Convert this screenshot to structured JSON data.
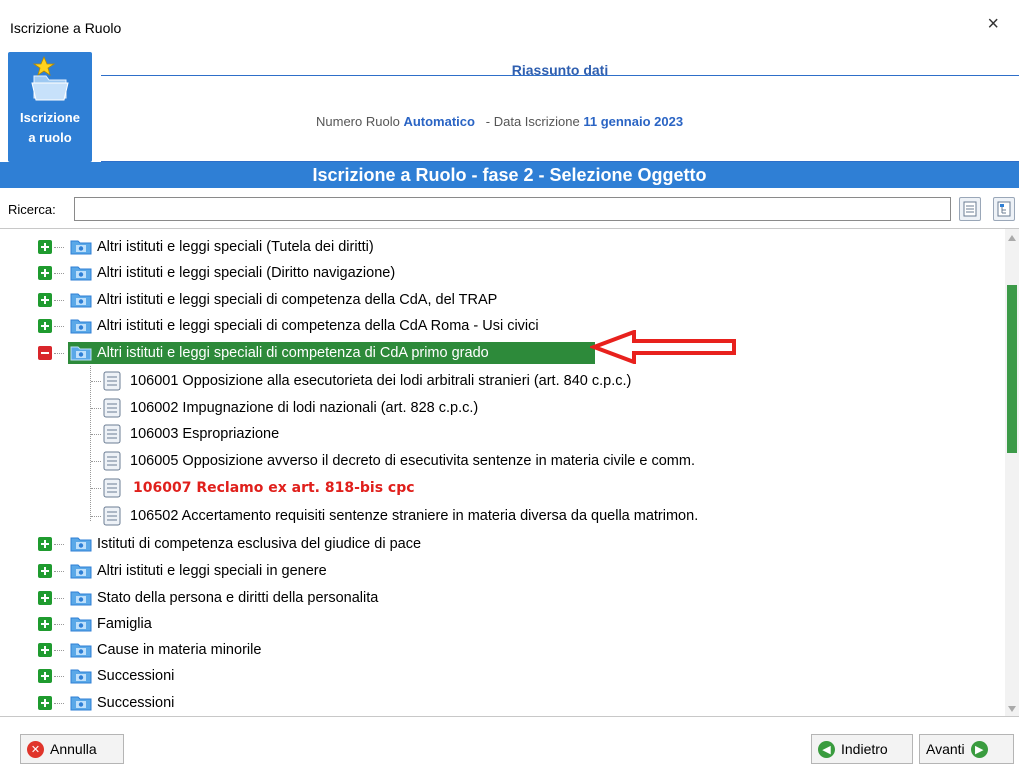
{
  "window": {
    "title": "Iscrizione a Ruolo",
    "close_glyph": "×"
  },
  "header": {
    "app_label_line1": "Iscrizione",
    "app_label_line2": "a ruolo",
    "summary_title": "Riassunto dati",
    "numero_label": "Numero Ruolo",
    "numero_value": "Automatico",
    "data_label": "- Data Iscrizione",
    "data_value": "11 gennaio 2023"
  },
  "phase_title": "Iscrizione a Ruolo - fase 2 - Selezione Oggetto",
  "search": {
    "label": "Ricerca:",
    "value": "",
    "placeholder": ""
  },
  "tree": {
    "items_before": [
      "Altri istituti e leggi speciali (Tutela dei diritti)",
      "Altri istituti e leggi speciali (Diritto navigazione)",
      "Altri istituti e leggi speciali di competenza della CdA, del TRAP",
      "Altri istituti e leggi speciali di competenza della CdA Roma - Usi civici"
    ],
    "selected": "Altri istituti e leggi speciali di competenza di CdA primo grado",
    "children": [
      "106001 Opposizione alla esecutorieta dei lodi arbitrali stranieri (art. 840 c.p.c.)",
      "106002 Impugnazione di lodi nazionali (art. 828 c.p.c.)",
      "106003 Espropriazione",
      "106005 Opposizione avverso il decreto di esecutivita sentenze in materia civile e comm.",
      "106007 Reclamo ex art. 818-bis cpc",
      "106502 Accertamento requisiti sentenze straniere in materia diversa da quella matrimon."
    ],
    "items_after": [
      "Istituti di competenza esclusiva del giudice di pace",
      "Altri istituti e leggi speciali in genere",
      "Stato della persona e diritti della personalita",
      "Famiglia",
      "Cause in materia minorile",
      "Successioni",
      "Successioni"
    ]
  },
  "buttons": {
    "annulla": "Annulla",
    "indietro": "Indietro",
    "avanti": "Avanti"
  },
  "colors": {
    "header_blue": "#2f7fd5",
    "selected_green": "#2d8a3a",
    "highlight_red": "#e0201c",
    "plus_green": "#1f9b2f",
    "minus_red": "#d9262b"
  }
}
